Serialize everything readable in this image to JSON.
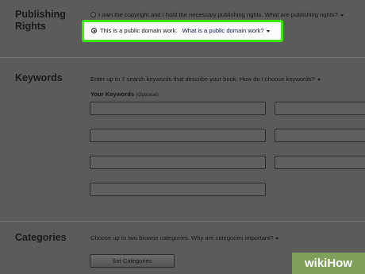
{
  "publishing_rights": {
    "title": "Publishing Rights",
    "option_copyright": "I own the copyright and I hold the necessary publishing rights.",
    "option_copyright_link": "What are publishing rights?",
    "option_public_domain": "This is a public domain work.",
    "option_public_domain_link": "What is a public domain work?"
  },
  "keywords": {
    "title": "Keywords",
    "description": "Enter up to 7 search keywords that describe your book.",
    "help_link": "How do I choose keywords?",
    "label": "Your Keywords",
    "label_optional": "(Optional)"
  },
  "categories": {
    "title": "Categories",
    "description": "Choose up to two browse categories.",
    "help_link": "Why are categories important?",
    "button_label": "Set Categories"
  },
  "watermark": {
    "text": "wikiHow"
  },
  "colors": {
    "background": "#5b5b5b",
    "highlight_border": "#3ee80c",
    "highlight_fill": "#fbfbfb",
    "watermark_bg": "#7ea05a"
  }
}
